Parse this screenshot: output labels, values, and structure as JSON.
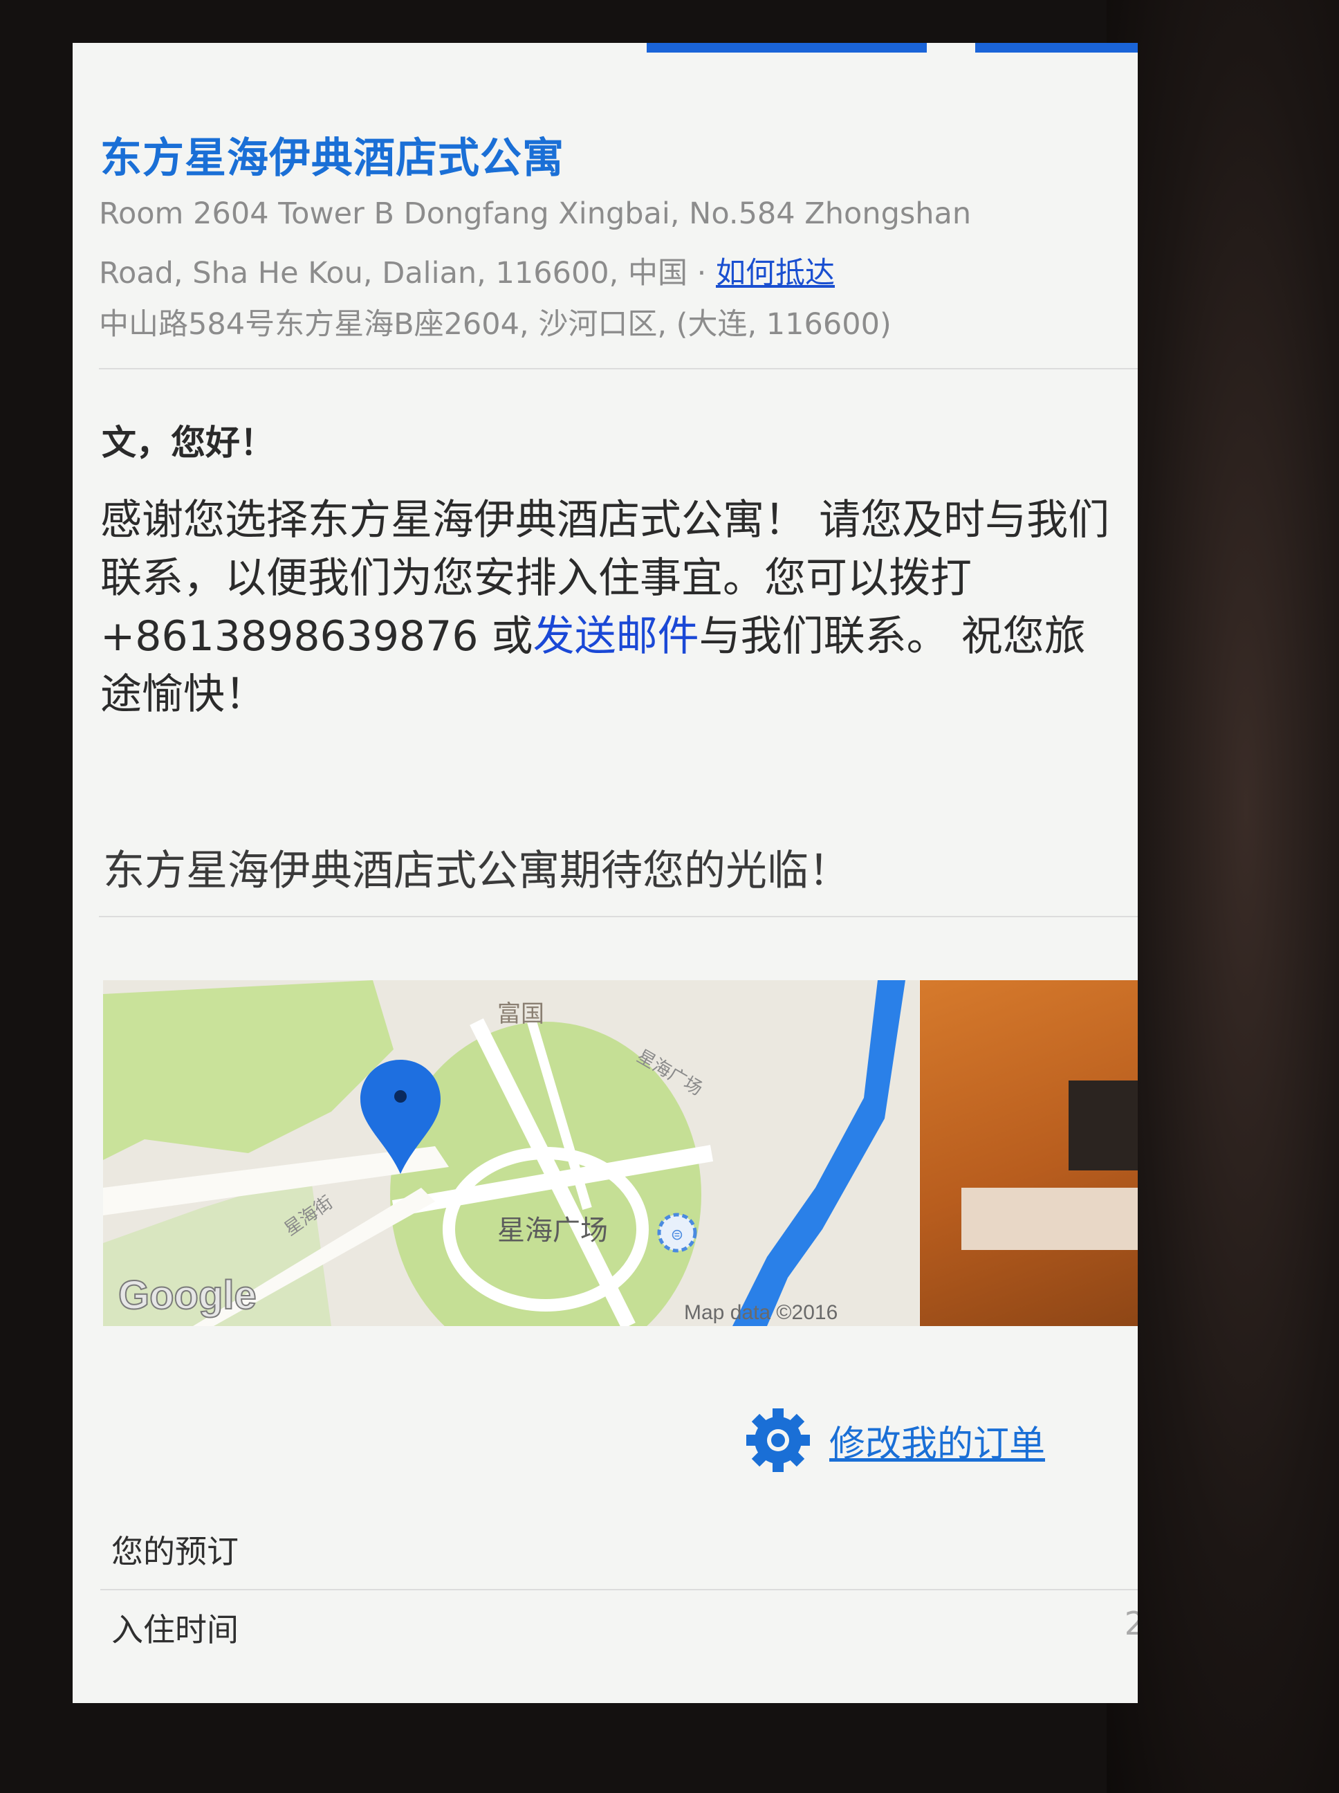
{
  "hotel": {
    "name": "东方星海伊典酒店式公寓",
    "address_en_line1": "Room 2604 Tower B Dongfang Xingbai, No.584 Zhongshan",
    "address_en_line2": "Road, Sha He Kou, Dalian, 116600, 中国 · ",
    "directions_link": "如何抵达",
    "address_cn": "中山路584号东方星海B座2604, 沙河口区, (大连, 116600)"
  },
  "message": {
    "greeting": "文，您好！",
    "body_before_phone": "感谢您选择东方星海伊典酒店式公寓！ 请您及时与我们联系，以便我们为您安排入住事宜。您可以拨打 ",
    "phone": "+8613898639876",
    "body_or": " 或",
    "email_link": "发送邮件",
    "body_after": "与我们联系。 祝您旅途愉快！",
    "closing": "东方星海伊典酒店式公寓期待您的光临！"
  },
  "map": {
    "label_north": "富国",
    "label_road_diag": "星海广场",
    "label_road_left": "星海街",
    "label_plaza": "星海广场",
    "logo": "Google",
    "attribution": "Map data ©2016",
    "pin_icon": "map-pin-icon",
    "transit_icon": "transit-icon"
  },
  "actions": {
    "modify_order": "修改我的订单",
    "gear_icon": "gear-icon"
  },
  "details": {
    "your_booking": "您的预订",
    "checkin_time": "入住时间",
    "checkin_value_partial": "2"
  },
  "colors": {
    "accent_blue": "#1a6fd6",
    "link_blue": "#1a48d6",
    "park_green": "#c9e29a",
    "river_blue": "#2a80e8"
  }
}
